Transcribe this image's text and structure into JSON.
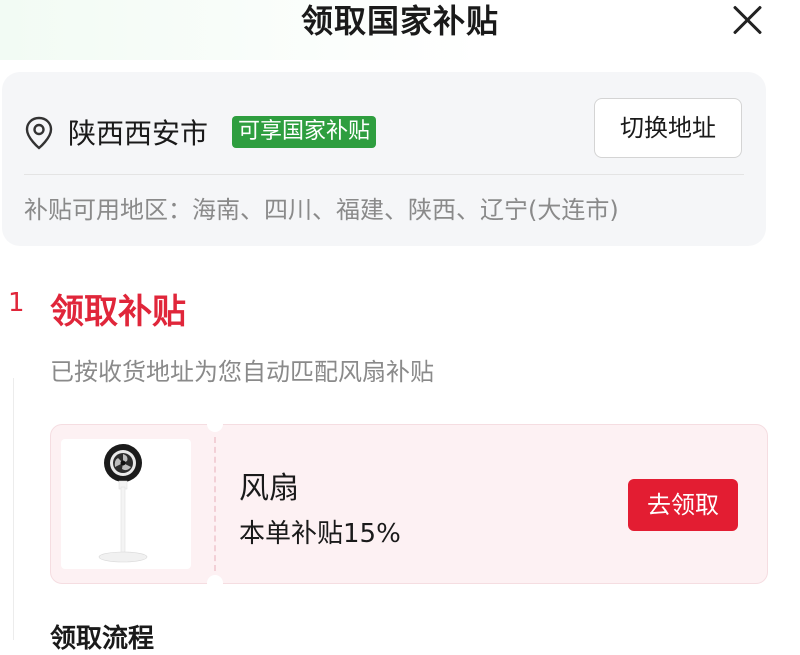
{
  "header": {
    "title": "领取国家补贴"
  },
  "address": {
    "location": "陕西西安市",
    "badge": "可享国家补贴",
    "switch_label": "切换地址",
    "region_label": "补贴可用地区：",
    "regions": "海南、四川、福建、陕西、辽宁(大连市)"
  },
  "step": {
    "number": "1",
    "title": "领取补贴",
    "description": "已按收货地址为您自动匹配风扇补贴"
  },
  "product": {
    "name": "风扇",
    "subsidy": "本单补贴15%",
    "claim_label": "去领取"
  },
  "process": {
    "heading": "领取流程"
  },
  "colors": {
    "accent_red": "#e31d32",
    "badge_green": "#2e9e3f",
    "card_bg": "#f5f6f8",
    "product_card_bg": "#fdf1f3"
  },
  "icons": [
    "close-icon",
    "location-pin-icon",
    "standing-fan-icon"
  ]
}
